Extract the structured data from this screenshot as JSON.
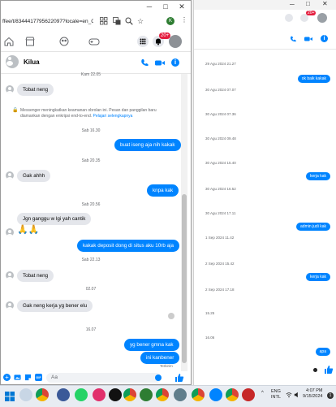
{
  "browser": {
    "url": "ffee/t/8344417795622097?locale=en_GB"
  },
  "fb_nav": {
    "badge": "20+"
  },
  "chat": {
    "name": "Kilua",
    "top_fragment": "Kam 22.05",
    "messages": [
      {
        "kind": "in",
        "text": "Tobat neng"
      },
      {
        "kind": "notice",
        "text": "Messenger meningkatkan keamanan obrolan ini. Pesan dan panggilan baru diamankan dengan enkripsi end-to-end.",
        "link": "Pelajari selengkapnya"
      },
      {
        "kind": "time",
        "text": "Sab 16.30"
      },
      {
        "kind": "out",
        "text": "buat iseng aja nih kakak"
      },
      {
        "kind": "time",
        "text": "Sab 20.35"
      },
      {
        "kind": "in",
        "text": "Gak ahhh"
      },
      {
        "kind": "out",
        "text": "knpa kak"
      },
      {
        "kind": "time",
        "text": "Sab 20.56"
      },
      {
        "kind": "in",
        "text": "Jgn ganggu w lgi yah cantik"
      },
      {
        "kind": "emoji",
        "text": "🙏🙏"
      },
      {
        "kind": "out",
        "text": "kakak deposit dong di situs aku 10rb aja"
      },
      {
        "kind": "time",
        "text": "Sab 22.13"
      },
      {
        "kind": "in",
        "text": "Tobat neng"
      },
      {
        "kind": "time",
        "text": "02.07"
      },
      {
        "kind": "in",
        "text": "Gak neng kerja yg bener elu"
      },
      {
        "kind": "time",
        "text": "16.07"
      },
      {
        "kind": "out",
        "text": "yg bener gmna kak"
      },
      {
        "kind": "out",
        "text": "ini kanbener"
      },
      {
        "kind": "status",
        "text": "Terkirim"
      }
    ],
    "composer_placeholder": "Aa"
  },
  "bg_window": {
    "badge": "20+",
    "items": [
      {
        "kind": "time",
        "text": "29 Agu 2024 21.27"
      },
      {
        "kind": "out",
        "text": "ok baik kakak"
      },
      {
        "kind": "time",
        "text": "30 Agu 2024 07.07"
      },
      {
        "kind": "time",
        "text": "30 Agu 2024 07.36"
      },
      {
        "kind": "time",
        "text": "30 Agu 2024 09.48"
      },
      {
        "kind": "time",
        "text": "30 Agu 2024 15.40"
      },
      {
        "kind": "out",
        "text": "kerja kak"
      },
      {
        "kind": "time",
        "text": "30 Agu 2024 16.52"
      },
      {
        "kind": "time",
        "text": "30 Agu 2024 17.11"
      },
      {
        "kind": "out",
        "text": "admin judi kak"
      },
      {
        "kind": "time",
        "text": "1 Sep 2024 11.42"
      },
      {
        "kind": "time",
        "text": "2 Sep 2024 15.42"
      },
      {
        "kind": "out",
        "text": "kerja kak"
      },
      {
        "kind": "time",
        "text": "2 Sep 2024 17.18"
      },
      {
        "kind": "time",
        "text": "15.25"
      },
      {
        "kind": "time",
        "text": "16.06"
      },
      {
        "kind": "out",
        "text": "apa"
      }
    ]
  },
  "taskbar": {
    "lang_line1": "ENG",
    "lang_line2": "INTL",
    "time": "4:07 PM",
    "date": "9/15/2024",
    "notif_count": "1"
  },
  "colors": {
    "accent": "#0084ff",
    "incoming": "#e4e6eb",
    "badge": "#e41e3f"
  }
}
